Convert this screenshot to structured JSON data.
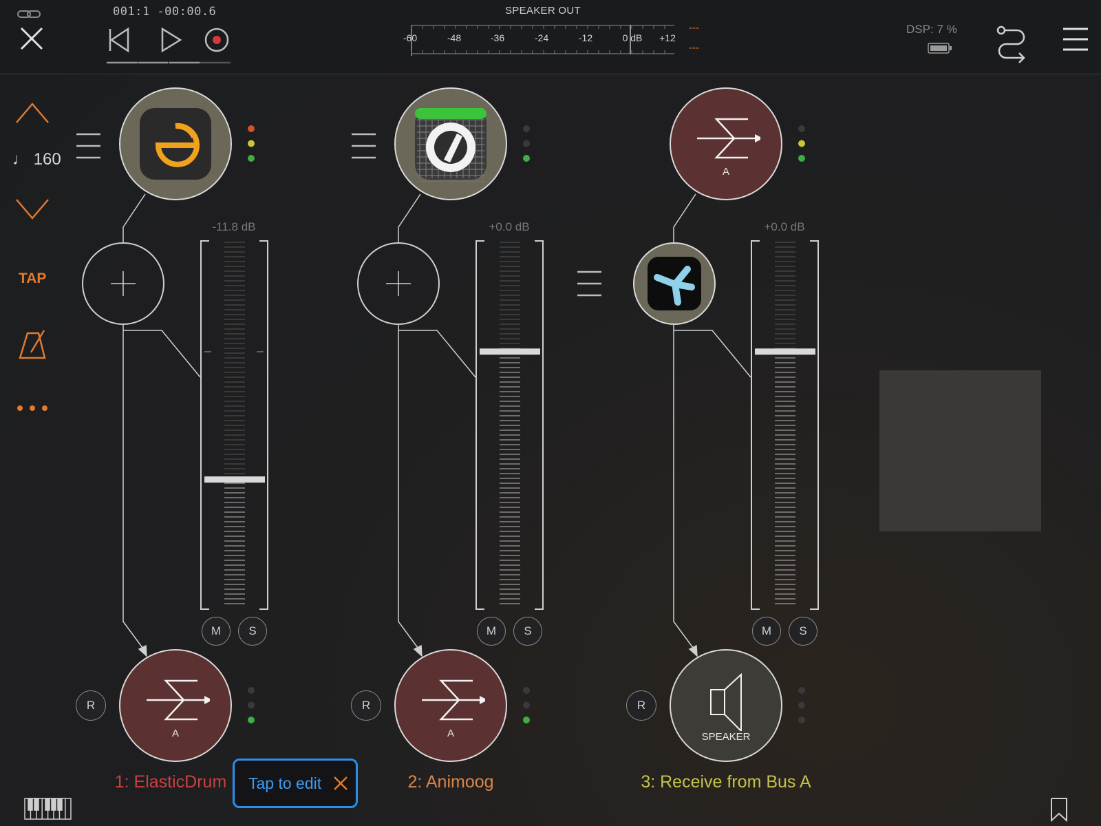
{
  "transport": {
    "timecode": "001:1 -00:00.6"
  },
  "speaker_meter": {
    "title": "SPEAKER OUT",
    "ticks": [
      "-60",
      "-48",
      "-36",
      "-24",
      "-12",
      "0 dB",
      "+12"
    ],
    "peak_left": "---",
    "peak_right": "---"
  },
  "status": {
    "dsp": "DSP:  7 %"
  },
  "sidebar": {
    "tempo": "♩ 160",
    "tap_label": "TAP"
  },
  "channels": [
    {
      "name": "1: ElasticDrum",
      "name_color": "#c8413f",
      "gain": "-11.8 dB",
      "fader_level": 0.35,
      "mute": "M",
      "solo": "S",
      "record": "R",
      "output_label": "A",
      "source_icon": "elasticdrum-app-icon",
      "output_icon": "bus-send-icon"
    },
    {
      "name": "2: Animoog",
      "name_color": "#d7864a",
      "gain": "+0.0 dB",
      "fader_level": 0.7,
      "mute": "M",
      "solo": "S",
      "record": "R",
      "output_label": "A",
      "source_icon": "animoog-app-icon",
      "output_icon": "bus-send-icon"
    },
    {
      "name": "3: Receive from Bus A",
      "name_color": "#c4c34a",
      "gain": "+0.0 dB",
      "fader_level": 0.7,
      "mute": "M",
      "solo": "S",
      "record": "R",
      "input_label": "A",
      "output_label": "SPEAKER",
      "source_icon": "bus-receive-icon",
      "effect_icon": "effect-app-icon",
      "output_icon": "speaker-icon"
    }
  ],
  "tooltip": {
    "text": "Tap to edit"
  },
  "colors": {
    "accent": "#e07a2e",
    "tooltip_border": "#2a8ef0",
    "led_green": "#3fae43",
    "led_yellow": "#c9c638",
    "led_red": "#d0542b",
    "led_off": "#3a3a3a"
  }
}
